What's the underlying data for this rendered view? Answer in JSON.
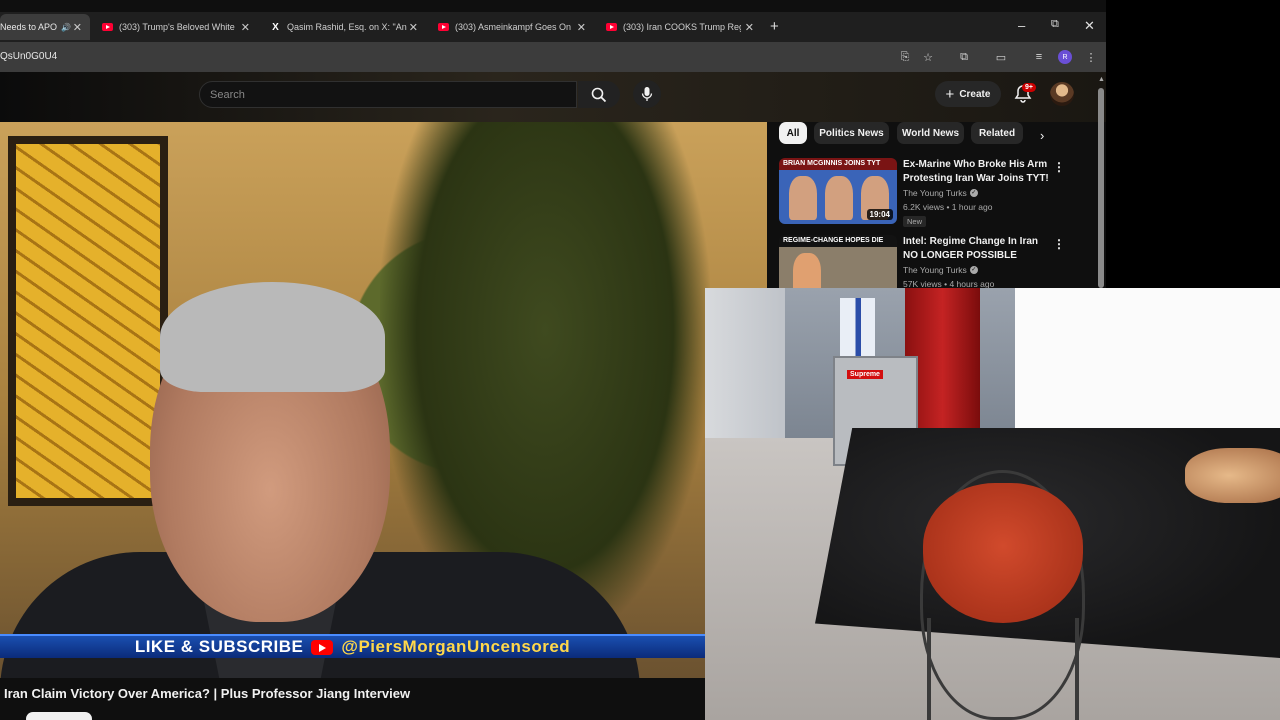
{
  "browser": {
    "tabs": [
      {
        "label": "Needs to APO",
        "active": true,
        "icon": "youtube-icon",
        "audio": true
      },
      {
        "label": "(303) Trump's Beloved White S",
        "icon": "youtube-icon"
      },
      {
        "label": "Qasim Rashid, Esq. on X: \"An u",
        "icon": "x-logo-icon"
      },
      {
        "label": "(303) Asmeinkampf Goes On I",
        "icon": "youtube-icon"
      },
      {
        "label": "(303) Iran COOKS Trump Regim",
        "icon": "youtube-icon"
      }
    ],
    "new_tab": "+",
    "window_controls": {
      "minimize": "–",
      "maximize": "⧉",
      "close": "✕"
    },
    "url": "QsUn0G0U4",
    "profile_initial": "R"
  },
  "youtube": {
    "search_placeholder": "Search",
    "create_label": "Create",
    "notification_count": "9+",
    "video": {
      "banner_text": "LIKE & SUBSCRIBE",
      "banner_handle": "@PiersMorganUncensored",
      "title": "Iran Claim Victory Over America? | Plus Professor Jiang Interview"
    },
    "chips": [
      "All",
      "Politics News",
      "World News",
      "Related"
    ],
    "recommendations": [
      {
        "thumb_caption": "BRIAN MCGINNIS JOINS TYT",
        "duration": "19:04",
        "title": "Ex-Marine Who Broke His Arm Protesting Iran War Joins TYT!",
        "channel": "The Young Turks",
        "meta": "6.2K views • 1 hour ago",
        "badge": "New"
      },
      {
        "thumb_caption": "REGIME-CHANGE HOPES DIE",
        "duration": "",
        "title": "Intel: Regime Change In Iran NO LONGER POSSIBLE",
        "channel": "The Young Turks",
        "meta": "57K views • 4 hours ago",
        "badge": ""
      }
    ]
  },
  "webcam": {
    "fridge_sticker": "Supreme"
  },
  "colors": {
    "youtube_red": "#ff0000",
    "banner_blue": "#1a4fb0",
    "handle_yellow": "#ffd84a"
  }
}
